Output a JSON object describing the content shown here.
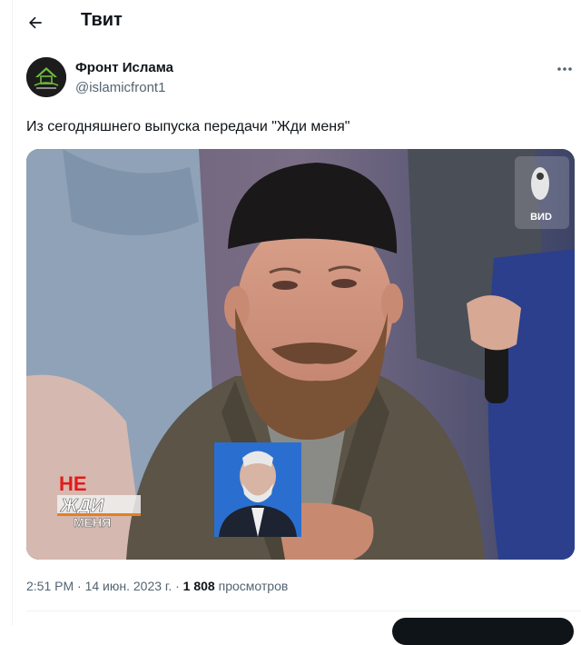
{
  "header": {
    "title": "Твит",
    "back_icon": "arrow-left-icon"
  },
  "author": {
    "name": "Фронт Ислама",
    "handle": "@islamicfront1",
    "avatar_icon": "organization-logo-avatar"
  },
  "more_icon": "more-horizontal-icon",
  "tweet": {
    "text": "Из сегодняшнего выпуска передачи \"Жди меня\""
  },
  "media": {
    "watermark": "ВИD",
    "show_logo": {
      "line1": "НЕ",
      "line2": "ЖДИ",
      "line3": "МЕНЯ"
    }
  },
  "footer": {
    "time": "2:51 PM",
    "sep": "·",
    "date": "14 июн. 2023 г.",
    "views_count": "1 808",
    "views_label": "просмотров"
  },
  "colors": {
    "text_primary": "#0f1419",
    "text_secondary": "#536471",
    "border": "#eff3f4"
  }
}
